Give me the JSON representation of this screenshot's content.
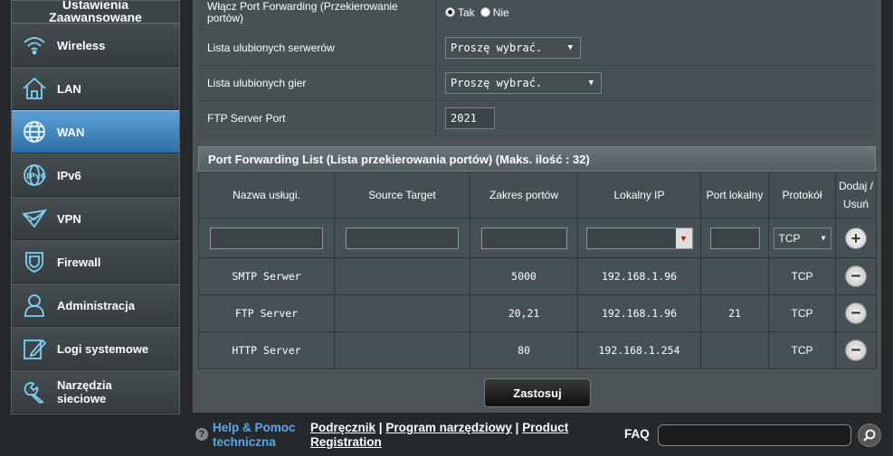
{
  "sidebar": {
    "title_line1": "Ustawienia",
    "title_line2": "Zaawansowane",
    "items": [
      {
        "label": "Wireless",
        "icon": "wifi-icon"
      },
      {
        "label": "LAN",
        "icon": "home-icon"
      },
      {
        "label": "WAN",
        "icon": "globe-icon",
        "active": true
      },
      {
        "label": "IPv6",
        "icon": "ipv6-icon"
      },
      {
        "label": "VPN",
        "icon": "vpn-icon"
      },
      {
        "label": "Firewall",
        "icon": "shield-icon"
      },
      {
        "label": "Administracja",
        "icon": "user-icon"
      },
      {
        "label": "Logi systemowe",
        "icon": "log-icon"
      },
      {
        "label": "Narzędzia sieciowe",
        "icon": "wrench-icon"
      }
    ]
  },
  "settings": {
    "enable_pf_label": "Włącz Port Forwarding (Przekierowanie portów)",
    "enable_pf_yes": "Tak",
    "enable_pf_no": "Nie",
    "enable_pf_value": "Tak",
    "fav_servers_label": "Lista ulubionych serwerów",
    "fav_servers_value": "Proszę wybrać.",
    "fav_games_label": "Lista ulubionych gier",
    "fav_games_value": "Proszę wybrać.",
    "ftp_port_label": "FTP Server Port",
    "ftp_port_value": "2021"
  },
  "pf_list": {
    "title": "Port Forwarding List (Lista przekierowania portów) (Maks. ilość : 32)",
    "columns": [
      "Nazwa usługi.",
      "Source Target",
      "Zakres portów",
      "Lokalny IP",
      "Port lokalny",
      "Protokół",
      "Dodaj / Usuń"
    ],
    "input_protocol": "TCP",
    "rows": [
      {
        "name": "SMTP Serwer",
        "source": "",
        "range": "5000",
        "ip": "192.168.1.96",
        "local_port": "",
        "protocol": "TCP"
      },
      {
        "name": "FTP Server",
        "source": "",
        "range": "20,21",
        "ip": "192.168.1.96",
        "local_port": "21",
        "protocol": "TCP"
      },
      {
        "name": "HTTP Server",
        "source": "",
        "range": "80",
        "ip": "192.168.1.254",
        "local_port": "",
        "protocol": "TCP"
      }
    ]
  },
  "apply_label": "Zastosuj",
  "footer": {
    "help_line1": "Help & Pomoc",
    "help_line2": "techniczna",
    "link_manual": "Podręcznik",
    "link_utility": "Program narzędziowy",
    "link_product": "Product",
    "link_registration": "Registration",
    "sep": "|",
    "faq": "FAQ"
  }
}
